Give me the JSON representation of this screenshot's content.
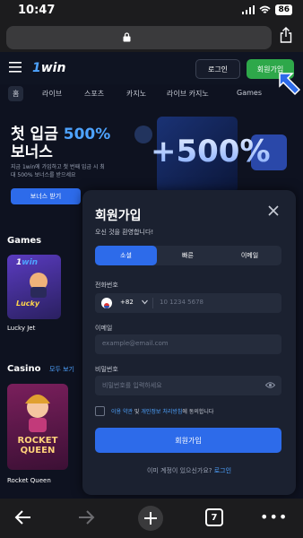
{
  "status": {
    "time": "10:47",
    "battery": "86"
  },
  "site": {
    "logo_a": "1",
    "logo_b": "win",
    "login_label": "로그인",
    "register_label": "회원가입"
  },
  "nav": [
    "홈",
    "라이브",
    "스포츠",
    "카지노",
    "라이브 카지노",
    "Games"
  ],
  "hero": {
    "title_line1": "첫 입금 ",
    "title_accent": "500%",
    "title_line2": "보너스",
    "subtitle": "지금 1win에 가입하고 첫 번째 입금 시 최대 500% 보너스를 받으세요",
    "bonus_button": "보너스 받기",
    "art_text": "+500%"
  },
  "sections": {
    "games_title": "Games",
    "lucky_brand_a": "1",
    "lucky_brand_b": "win",
    "lucky_card_text": "Lucky",
    "lucky_label": "Lucky Jet",
    "casino_title": "Casino",
    "casino_all": "모두 보기",
    "rocket_card_text": "ROCKET QUEEN",
    "rocket_label": "Rocket Queen"
  },
  "modal": {
    "title": "회원가입",
    "subtitle": "오신 것을 환영합니다!",
    "tabs": [
      "소셜",
      "빠른",
      "이메일"
    ],
    "phone_label": "전화번호",
    "country_code": "+82",
    "phone_placeholder": "10 1234 5678",
    "email_label": "이메일",
    "email_placeholder": "example@email.com",
    "password_label": "비밀번호",
    "password_placeholder": "비밀번호를 입력하세요",
    "terms_link1": "이용 약관",
    "terms_and": " 및 ",
    "terms_link2": "개인정보 처리방침",
    "terms_tail": "에 동의합니다",
    "submit_label": "회원가입",
    "have_account": "이미 계정이 있으신가요? ",
    "login_link": "로그인"
  },
  "toolbar": {
    "tabs_count": "7"
  },
  "colors": {
    "accent": "#2d6bea",
    "register_green": "#2ea84a",
    "link": "#4ea3ff"
  }
}
